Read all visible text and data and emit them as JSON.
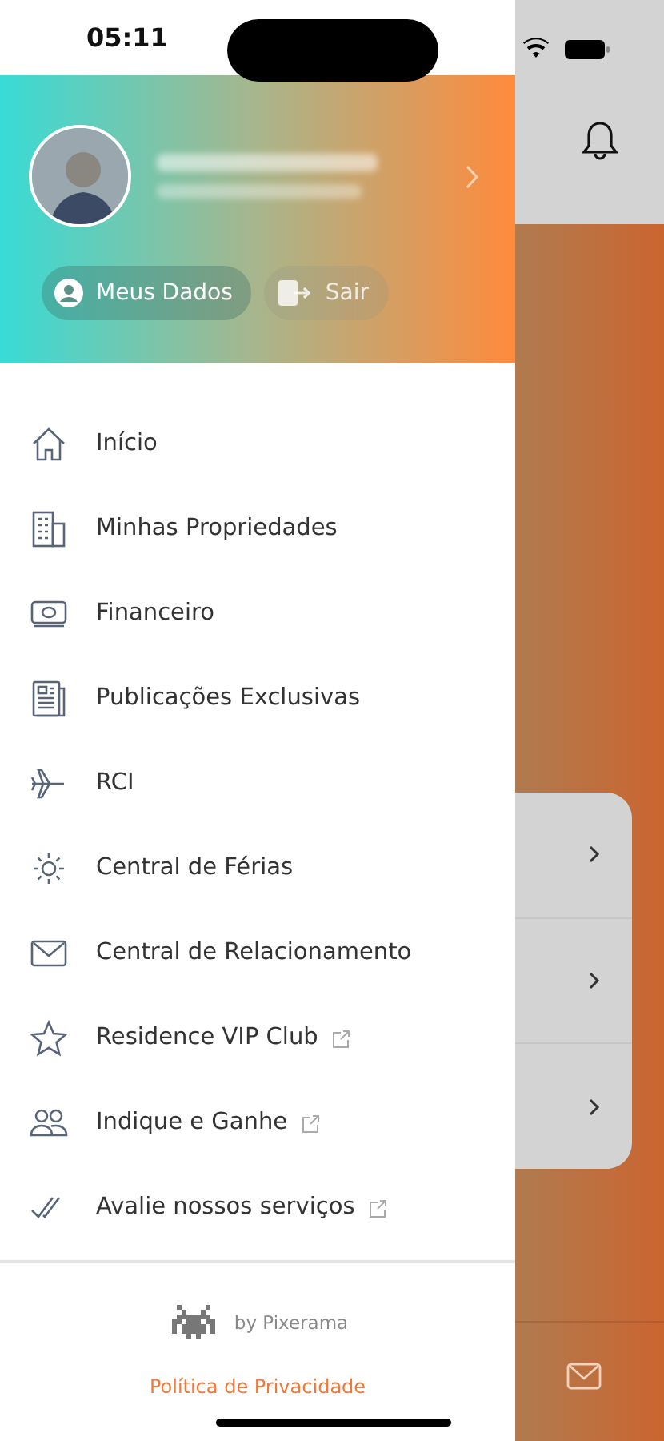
{
  "status_bar": {
    "time": "05:11"
  },
  "profile": {
    "buttons": [
      {
        "label": "Meus Dados"
      },
      {
        "label": "Sair"
      }
    ]
  },
  "menu": [
    {
      "label": "Início",
      "external": false
    },
    {
      "label": "Minhas Propriedades",
      "external": false
    },
    {
      "label": "Financeiro",
      "external": false
    },
    {
      "label": "Publicações Exclusivas",
      "external": false
    },
    {
      "label": "RCI",
      "external": false
    },
    {
      "label": "Central de Férias",
      "external": false
    },
    {
      "label": "Central de Relacionamento",
      "external": false
    },
    {
      "label": "Residence VIP Club",
      "external": true
    },
    {
      "label": "Indique e Ganhe",
      "external": true
    },
    {
      "label": "Avalie nossos serviços",
      "external": true
    }
  ],
  "footer": {
    "credit": "by Pixerama",
    "privacy_link": "Política de Privacidade"
  }
}
